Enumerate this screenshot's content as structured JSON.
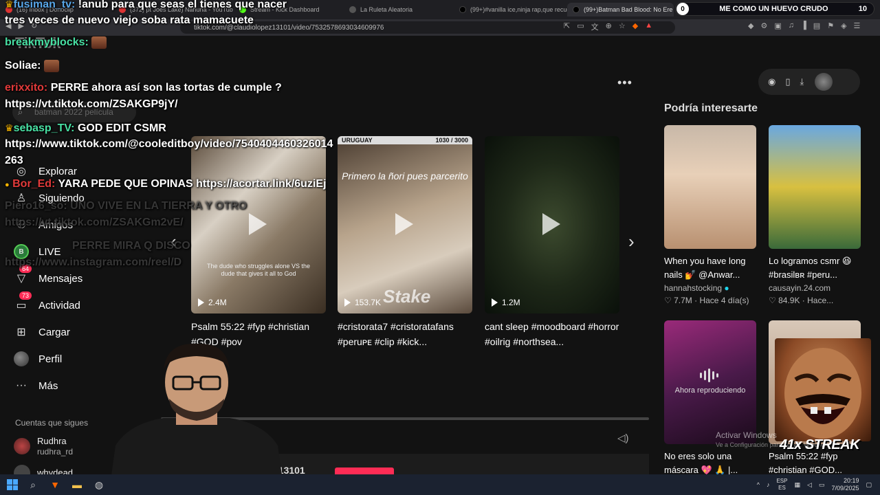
{
  "browser": {
    "tabs": [
      {
        "label": "(16) Inbox | Donoclip",
        "x": 0
      },
      {
        "label": "(372) pt Joes Lake) Nahuna - YouTub",
        "x": 1
      },
      {
        "label": "Stream - Kick Dashboard",
        "x": 2
      },
      {
        "label": "La Ruleta Aleatoria",
        "x": 3
      },
      {
        "label": "(99+)#vanilla ice,ninja rap,que recue",
        "x": 4
      },
      {
        "label": "(99+)Batman Bad Blood: No Ere",
        "x": 5
      }
    ],
    "url": "tiktok.com/@claudiolopez13101/video/7532578693034609976"
  },
  "goal": {
    "start": "0",
    "label": "ME COMO UN HUEVO CRUDO",
    "end": "10"
  },
  "chat": [
    {
      "user": "fusiman_tv:",
      "msg": " !anub para que seas el tienes que nacer"
    },
    {
      "user": "",
      "msg": "tres veces de nuevo viejo soba rata mamacuete"
    },
    {
      "user": "breakmyblocks:",
      "msg": ""
    },
    {
      "user": "Soliae:",
      "msg": ""
    },
    {
      "user": "erixxito:",
      "msg": " PERRE ahora así son las tortas de cumple ?"
    },
    {
      "user": "",
      "msg": "https://vt.tiktok.com/ZSAKGP9jY/"
    },
    {
      "user": "sebasp_TV:",
      "msg": " GOD EDIT CSMR"
    },
    {
      "user": "",
      "msg": "https://www.tiktok.com/@cooleditboy/video/7540404460326014"
    },
    {
      "user": "",
      "msg": "263"
    },
    {
      "user": "Bor_Ed:",
      "msg": " YARA PEDE QUE OPINAS https://acortar.link/6uziEj"
    },
    {
      "user": "Piero16_so:",
      "msg": " UNO VIVE EN LA TIERRA Y OTRO"
    },
    {
      "user": "",
      "msg": "https://vt.tiktok.com/ZSAKGm2vE/"
    },
    {
      "user": "",
      "msg": "PERRE MIRA Q DISCO"
    },
    {
      "user": "",
      "msg": "https://www.instagram.com/reel/D"
    }
  ],
  "tiktok": {
    "logo": "TikTok",
    "search_placeholder": "batman 2022 película",
    "nav": [
      {
        "label": "Explorar",
        "icon": "compass-icon",
        "badge": ""
      },
      {
        "label": "Siguiendo",
        "icon": "following-icon",
        "badge": ""
      },
      {
        "label": "Amigos",
        "icon": "friends-icon",
        "badge": ""
      },
      {
        "label": "LIVE",
        "icon": "live-icon",
        "badge": ""
      },
      {
        "label": "Mensajes",
        "icon": "messages-icon",
        "badge": "64"
      },
      {
        "label": "Actividad",
        "icon": "activity-icon",
        "badge": "73"
      },
      {
        "label": "Cargar",
        "icon": "upload-icon",
        "badge": ""
      },
      {
        "label": "Perfil",
        "icon": "profile-icon",
        "badge": ""
      },
      {
        "label": "Más",
        "icon": "more-icon",
        "badge": ""
      }
    ],
    "follows_title": "Cuentas que sigues",
    "follows": [
      {
        "name": "Rudhra",
        "handle": "rudhra_rd"
      },
      {
        "name": "whydead",
        "handle": ""
      }
    ],
    "videos": [
      {
        "views": "2.4M",
        "desc": "Psalm 55:22 #fyp #christian #GOD #pov",
        "caption": "The dude who struggles alone VS the dude that gives it all to God",
        "overlay": "",
        "banner_left": "",
        "banner_right": ""
      },
      {
        "views": "153.7K",
        "desc": "#cristorata7 #cristoratafans #peruᴘᴇ #clip #kick...",
        "caption": "",
        "overlay": "Primero la ñori pues parcerito",
        "banner_left": "URUGUAY",
        "banner_right": "1030 / 3000"
      },
      {
        "views": "1.2M",
        "desc": "cant sleep #moodboard #horror #oilrig #northsea...",
        "caption": "",
        "overlay": "",
        "banner_left": "",
        "banner_right": ""
      }
    ],
    "bottom_user": "ez13101",
    "suggest_title": "Podría interesarte",
    "suggestions": [
      {
        "desc": "When you have long nails 💅 @Anwar...",
        "author": "hannahstocking",
        "likes": "7.7M",
        "when": "Hace 4 día(s)"
      },
      {
        "desc": "Lo logramos csmr 😆 #brasilʙʀ #peru...",
        "author": "causayin.24.com",
        "likes": "84.9K",
        "when": "Hace..."
      },
      {
        "desc": "No eres solo una máscara 💖 🙏 |...",
        "author": "",
        "likes": "",
        "when": ""
      },
      {
        "desc": "Psalm 55:22 #fyp #christian #GOD...",
        "author": "",
        "likes": "",
        "when": ""
      }
    ],
    "now_playing": "Ahora reproduciendo"
  },
  "overlay": {
    "streak": "41x STREAK",
    "activate": "Activar Windows",
    "activate_sub": "Ve a Configuración para activar Windows."
  },
  "taskbar": {
    "lang1": "ESP",
    "lang2": "ES",
    "time": "20:19",
    "date": "7/09/2025"
  },
  "colors": {
    "tiktok_red": "#fe2c55",
    "chat_green": "#48e0a3",
    "chat_red": "#e23a3a",
    "taskbar": "#1b2230"
  }
}
